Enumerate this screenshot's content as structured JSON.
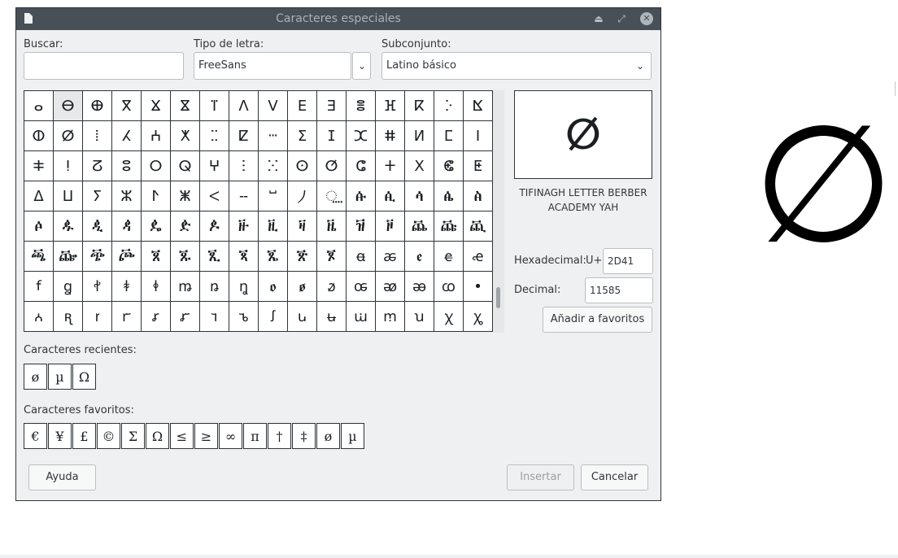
{
  "window": {
    "title": "Caracteres especiales"
  },
  "search": {
    "label": "Buscar:",
    "value": ""
  },
  "font": {
    "label": "Tipo de letra:",
    "value": "FreeSans"
  },
  "subset": {
    "label": "Subconjunto:",
    "value": "Latino básico"
  },
  "grid": {
    "selected_index": 1,
    "chars": [
      "ⴰ",
      "ⴱ",
      "ⴲ",
      "ⴳ",
      "ⴴ",
      "ⴵ",
      "ⴶ",
      "ⴷ",
      "ⴸ",
      "ⴹ",
      "ⴺ",
      "ⴻ",
      "ⴼ",
      "ⴽ",
      "ⴾ",
      "ⴿ",
      "ⵀ",
      "ⵁ",
      "ⵂ",
      "ⵃ",
      "ⵄ",
      "ⵅ",
      "ⵆ",
      "ⵇ",
      "ⵈ",
      "ⵉ",
      "ⵊ",
      "ⵋ",
      "ⵌ",
      "ⵍ",
      "ⵎ",
      "ⵏ",
      "ⵐ",
      "ⵑ",
      "ⵒ",
      "ⵓ",
      "ⵔ",
      "ⵕ",
      "ⵖ",
      "ⵗ",
      "ⵘ",
      "ⵙ",
      "ⵚ",
      "ⵛ",
      "ⵜ",
      "ⵝ",
      "ⵞ",
      "ⵟ",
      "ⵠ",
      "ⵡ",
      "ⵢ",
      "ⵣ",
      "ⵤ",
      "ⵥ",
      "ⵦ",
      "ⵧ",
      "ⵯ",
      "⵰",
      "⵿",
      "ꬁ",
      "ꬂ",
      "ꬃ",
      "ꬄ",
      "ꬅ",
      "ꬆ",
      "ꬉ",
      "ꬊ",
      "ꬋ",
      "ꬌ",
      "ꬍ",
      "ꬎ",
      "ꬑ",
      "ꬒ",
      "ꬓ",
      "ꬔ",
      "ꬕ",
      "ꬖ",
      "ꬠ",
      "ꬡ",
      "ꬢ",
      "ꬣ",
      "ꬤ",
      "ꬥ",
      "ꬦ",
      "ꬨ",
      "ꬩ",
      "ꬪ",
      "ꬫ",
      "ꬬ",
      "ꬭ",
      "ꬮ",
      "ꬰ",
      "ꬱ",
      "ꬲ",
      "ꬳ",
      "ꬴ",
      "ꬵ",
      "ꬶ",
      "ꬷ",
      "ꬸ",
      "ꬹ",
      "ꬺ",
      "ꬻ",
      "ꬼ",
      "ꬽ",
      "ꬾ",
      "ꬿ",
      "ꭀ",
      "ꭁ",
      "ꭂ",
      "ꭃ",
      "•",
      "ꭅ",
      "ꭆ",
      "ꭇ",
      "ꭈ",
      "ꭉ",
      "ꭊ",
      "ꭋ",
      "ꭌ",
      "ꭍ",
      "ꭎ",
      "ꭏ",
      "ꭐ",
      "ꭑ",
      "ꭒ",
      "ꭓ",
      "ꭔ"
    ]
  },
  "preview": {
    "char": "ⵁ",
    "name": "TIFINAGH LETTER BERBER ACADEMY YAH"
  },
  "hex": {
    "label": "Hexadecimal:",
    "prefix": "U+",
    "value": "2D41"
  },
  "decimal": {
    "label": "Decimal:",
    "value": "11585"
  },
  "buttons": {
    "add_favorite": "Añadir a favoritos",
    "help": "Ayuda",
    "insert": "Insertar",
    "cancel": "Cancelar"
  },
  "recent": {
    "label": "Caracteres recientes:",
    "chars": [
      "ø",
      "µ",
      "Ω"
    ]
  },
  "favorites": {
    "label": "Caracteres favoritos:",
    "chars": [
      "€",
      "¥",
      "£",
      "©",
      "Σ",
      "Ω",
      "≤",
      "≥",
      "∞",
      "π",
      "†",
      "‡",
      "ø",
      "µ"
    ]
  },
  "document_preview_char": "∅"
}
